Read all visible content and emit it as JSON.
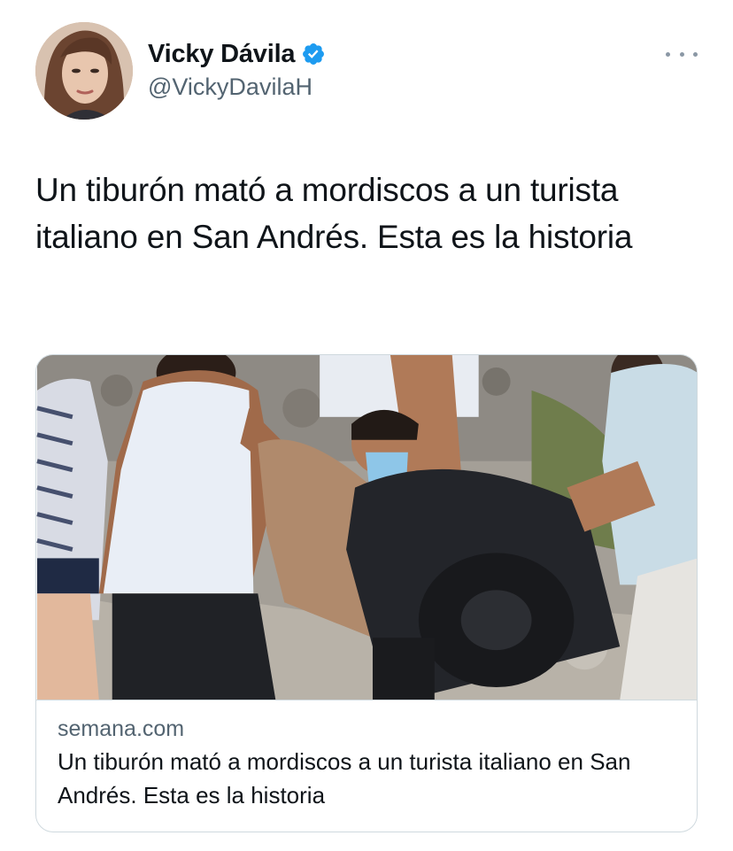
{
  "author": {
    "display_name": "Vicky Dávila",
    "handle": "@VickyDavilaH",
    "verified": true,
    "avatar_icon": "profile-photo"
  },
  "menu": {
    "icon": "more-dots-icon"
  },
  "tweet": {
    "text": "Un tiburón mató a mordiscos a un turista italiano en San Andrés. Esta es la historia"
  },
  "link_card": {
    "image_icon": "news-photo",
    "domain": "semana.com",
    "title": "Un tiburón mató a mordiscos a un turista italiano en San Andrés. Esta es la historia"
  },
  "colors": {
    "verified_blue": "#1d9bf0",
    "secondary_text": "#536471",
    "border": "#cfd9de"
  }
}
